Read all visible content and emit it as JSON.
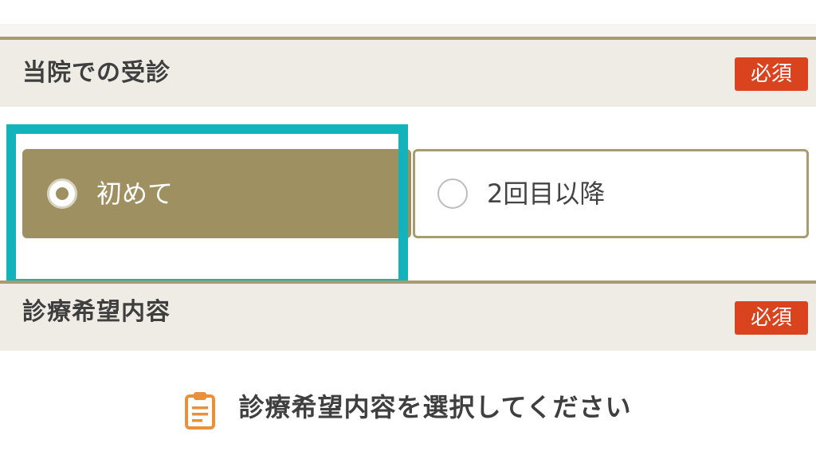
{
  "sections": [
    {
      "title": "当院での受診",
      "required_label": "必須",
      "options": [
        {
          "label": "初めて",
          "selected": true
        },
        {
          "label": "2回目以降",
          "selected": false
        }
      ]
    },
    {
      "title": "診療希望内容",
      "required_label": "必須",
      "select_prompt": "診療希望内容を選択してください"
    }
  ],
  "icons": {
    "select_prompt_icon": "clipboard-icon"
  },
  "colors": {
    "accent_gold": "#9f9061",
    "header_bg": "#eeece5",
    "header_border": "#a79c6d",
    "required_badge": "#d9441f",
    "highlight": "#12b3ba",
    "icon_orange": "#e8913a"
  }
}
